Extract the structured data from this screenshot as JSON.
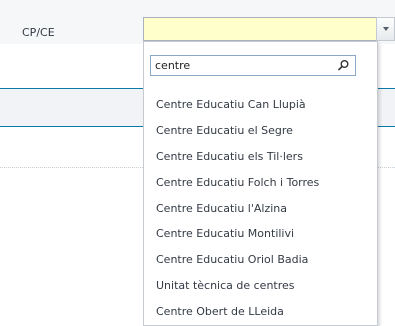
{
  "field": {
    "label": "CP/CE",
    "value": ""
  },
  "dropdown": {
    "search_value": "centre",
    "options": [
      "Centre Educatiu Can Llupià",
      "Centre Educatiu el Segre",
      "Centre Educatiu els Til·lers",
      "Centre Educatiu Folch i Torres",
      "Centre Educatiu l'Alzina",
      "Centre Educatiu Montilivi",
      "Centre Educatiu Oriol Badia",
      "Unitat tècnica de centres",
      "Centre Obert de LLeida"
    ]
  },
  "icons": {
    "search": "search-icon",
    "dropdown_arrow": "chevron-down-icon"
  },
  "colors": {
    "field_background": "#ffffcc",
    "accent_line": "#0a7ba6",
    "text": "#333a44"
  }
}
